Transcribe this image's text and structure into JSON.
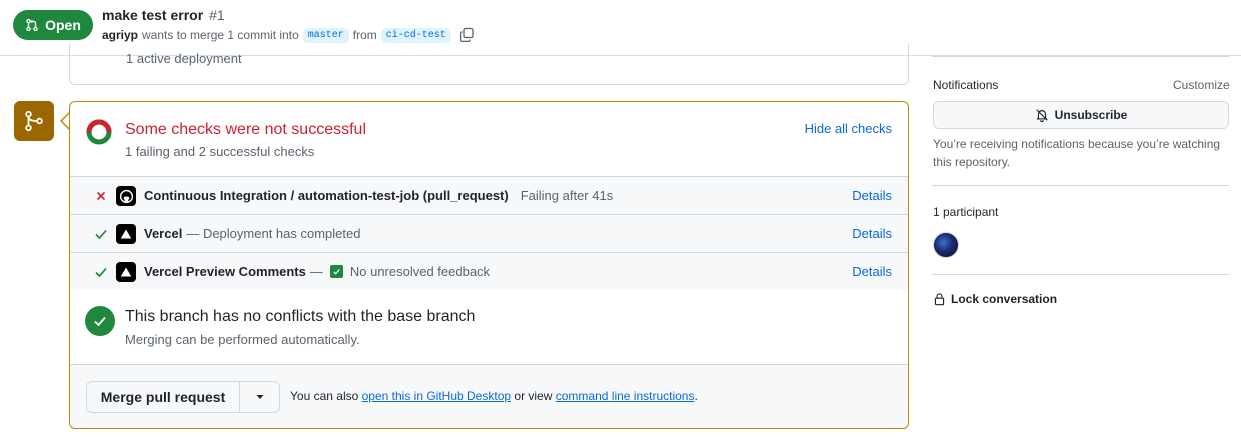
{
  "header": {
    "status_label": "Open",
    "title": "make test error",
    "number": "#1",
    "author": "agriyp",
    "merge_text_pre": "wants to merge 1 commit into",
    "base_branch": "master",
    "from_text": "from",
    "head_branch": "ci-cd-test"
  },
  "deployment": {
    "text": "1 active deployment"
  },
  "checks": {
    "title": "Some checks were not successful",
    "subtitle": "1 failing and 2 successful checks",
    "hide_link": "Hide all checks",
    "rows": [
      {
        "name": "Continuous Integration / automation-test-job (pull_request)",
        "status": "Failing after 41s",
        "details": "Details"
      },
      {
        "name": "Vercel",
        "status": "— Deployment has completed",
        "details": "Details"
      },
      {
        "name": "Vercel Preview Comments",
        "status_sep": "—",
        "status": "No unresolved feedback",
        "details": "Details"
      }
    ]
  },
  "conflicts": {
    "title": "This branch has no conflicts with the base branch",
    "subtitle": "Merging can be performed automatically."
  },
  "merge": {
    "button_label": "Merge pull request",
    "note_pre": "You can also",
    "desktop_link": "open this in GitHub Desktop",
    "note_mid": "or view",
    "cli_link": "command line instructions",
    "note_end": "."
  },
  "sidebar": {
    "notifications_heading": "Notifications",
    "customize": "Customize",
    "unsubscribe_label": "Unsubscribe",
    "notif_desc": "You’re receiving notifications because you’re watching this repository.",
    "participants_heading": "1 participant",
    "lock_label": "Lock conversation"
  },
  "colors": {
    "open_green": "#1f883d",
    "fail_red": "#cf222e",
    "link_blue": "#0969da",
    "merge_box_border": "#bf8700"
  }
}
